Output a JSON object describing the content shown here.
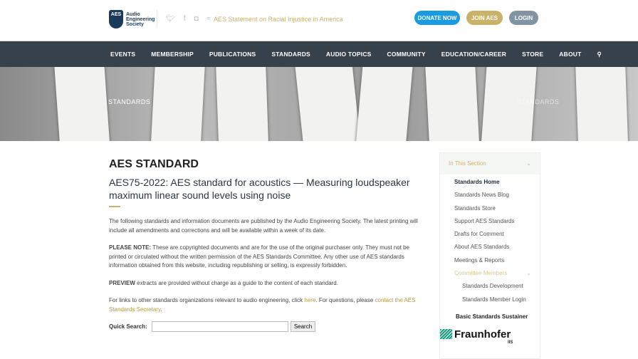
{
  "header": {
    "logo_text": [
      "Audio",
      "Engineering",
      "Society"
    ],
    "logo_mark": "AES",
    "social_icons": [
      "twitter-icon",
      "facebook-icon",
      "instagram-icon",
      "rss-icon"
    ],
    "statement": "AES Statement on Racial Injustice in America",
    "donate": "DONATE NOW",
    "join": "JOIN AES",
    "login": "LOGIN",
    "colors": {
      "donate": "#1a9be0",
      "join": "#c9b26a",
      "login": "#8293a3"
    }
  },
  "nav": [
    "EVENTS",
    "MEMBERSHIP",
    "PUBLICATIONS",
    "STANDARDS",
    "AUDIO TOPICS",
    "COMMUNITY",
    "EDUCATION/CAREER",
    "STORE",
    "ABOUT"
  ],
  "banner": {
    "left": "STANDARDS",
    "right": "STANDARDS"
  },
  "main": {
    "title": "AES STANDARD",
    "subtitle": "AES75-2022: AES standard for acoustics — Measuring loudspeaker maximum linear sound levels using noise",
    "p1": "The following standards and information documents are published by the Audio Engineering Society. The latest printing will include all amendments and corrections and will be available within a week of its date.",
    "p2_bold": "PLEASE NOTE:",
    "p2": " These are copyrighted documents and are for the use of the original purchaser only. They must not be printed or circulated without the written permission of the AES Standards Committee. Any other use of AES standards information obtained from this website, including republishing or selling, is expressly forbidden.",
    "p3_bold": "PREVIEW",
    "p3": " extracts are provided without charge as a guide to the content of each standard.",
    "p4a": "For links to other standards organizations relevant to audio engineering, click ",
    "p4link1": "here",
    "p4b": ". For questions, please ",
    "p4link2": "contact the AES Standards Secretary",
    "p4c": ".",
    "qs_label": "Quick Search:",
    "qs_value": "",
    "qs_button": "Search"
  },
  "sidebar": {
    "header": "In This Section",
    "items": [
      "Standards Home",
      "Standards News Blog",
      "Standards Store",
      "Support AES Standards",
      "Drafts for Comment",
      "About AES Standards",
      "Meetings & Reports",
      "Committee Members"
    ],
    "subitems": [
      "Standards Development",
      "Standards Member Login"
    ],
    "sustainer": "Basic Standards Sustainer",
    "sponsor": "Fraunhofer",
    "sponsor_sub": "IIS"
  }
}
